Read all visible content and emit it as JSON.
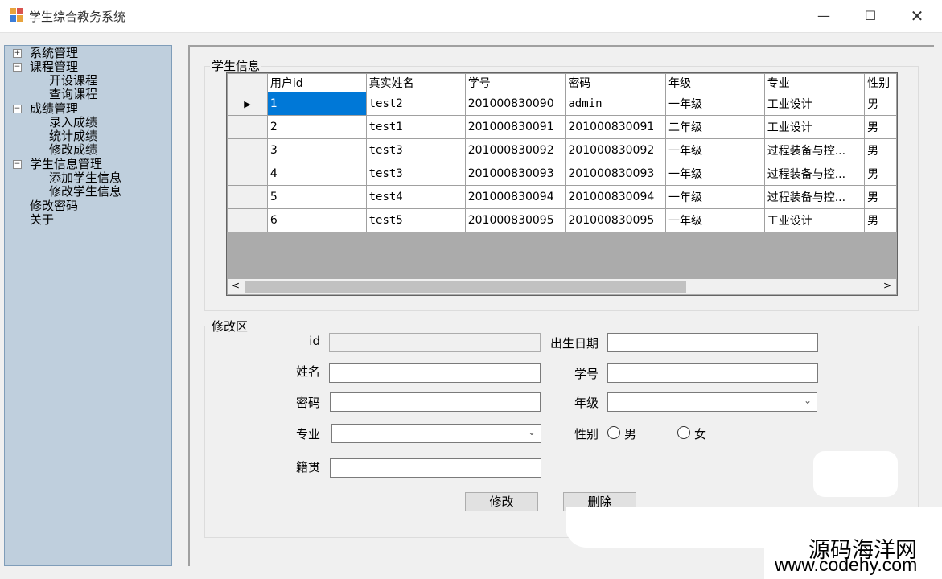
{
  "window": {
    "title": "学生综合教务系统"
  },
  "sidebar": {
    "items": [
      {
        "label": "系统管理",
        "toggle": "+"
      },
      {
        "label": "课程管理",
        "toggle": "−"
      },
      {
        "label": "开设课程"
      },
      {
        "label": "查询课程"
      },
      {
        "label": "成绩管理",
        "toggle": "−"
      },
      {
        "label": "录入成绩"
      },
      {
        "label": "统计成绩"
      },
      {
        "label": "修改成绩"
      },
      {
        "label": "学生信息管理",
        "toggle": "−"
      },
      {
        "label": "添加学生信息"
      },
      {
        "label": "修改学生信息"
      },
      {
        "label": "修改密码"
      },
      {
        "label": "关于"
      }
    ]
  },
  "student_info": {
    "group_title": "学生信息",
    "columns": [
      "用户id",
      "真实姓名",
      "学号",
      "密码",
      "年级",
      "专业",
      "性别"
    ],
    "rows": [
      [
        "1",
        "test2",
        "201000830090",
        "admin",
        "一年级",
        "工业设计",
        "男"
      ],
      [
        "2",
        "test1",
        "201000830091",
        "201000830091",
        "二年级",
        "工业设计",
        "男"
      ],
      [
        "3",
        "test3",
        "201000830092",
        "201000830092",
        "一年级",
        "过程装备与控...",
        "男"
      ],
      [
        "4",
        "test3",
        "201000830093",
        "201000830093",
        "一年级",
        "过程装备与控...",
        "男"
      ],
      [
        "5",
        "test4",
        "201000830094",
        "201000830094",
        "一年级",
        "过程装备与控...",
        "男"
      ],
      [
        "6",
        "test5",
        "201000830095",
        "201000830095",
        "一年级",
        "工业设计",
        "男"
      ]
    ]
  },
  "edit_area": {
    "group_title": "修改区",
    "labels": {
      "id": "id",
      "name": "姓名",
      "password": "密码",
      "major": "专业",
      "hometown": "籍贯",
      "birthdate": "出生日期",
      "student_no": "学号",
      "grade": "年级",
      "gender": "性别"
    },
    "gender_options": [
      "男",
      "女"
    ],
    "buttons": {
      "modify": "修改",
      "delete": "删除"
    }
  },
  "watermark": {
    "line1": "源码海洋网",
    "line2": "www.codehy.com"
  }
}
